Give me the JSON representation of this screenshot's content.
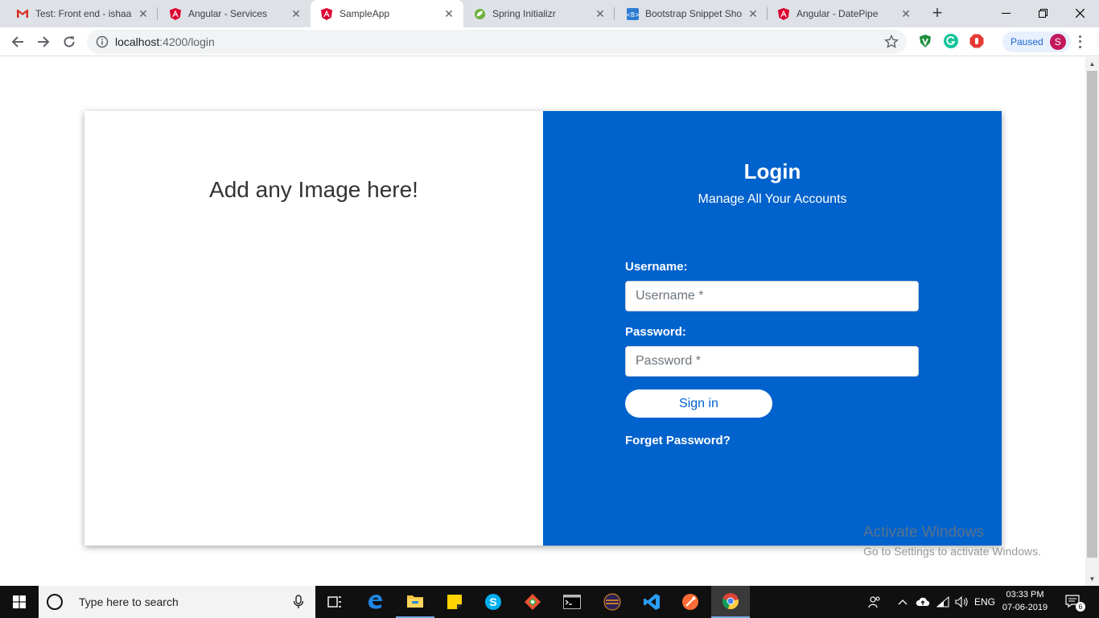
{
  "browser": {
    "tabs": [
      {
        "title": "Test: Front end - ishaan",
        "icon": "gmail-icon"
      },
      {
        "title": "Angular - Services",
        "icon": "angular-icon"
      },
      {
        "title": "SampleApp",
        "icon": "angular-icon",
        "active": true
      },
      {
        "title": "Spring Initializr",
        "icon": "spring-icon"
      },
      {
        "title": "Bootstrap Snippet Shop",
        "icon": "bootstrap-icon"
      },
      {
        "title": "Angular - DatePipe",
        "icon": "angular-icon"
      }
    ],
    "url_host": "localhost",
    "url_path": ":4200/login",
    "profile_status": "Paused",
    "profile_initial": "S"
  },
  "page": {
    "image_placeholder": "Add any Image here!",
    "login_title": "Login",
    "login_subtitle": "Manage All Your Accounts",
    "username_label": "Username:",
    "username_placeholder": "Username *",
    "password_label": "Password:",
    "password_placeholder": "Password *",
    "signin_label": "Sign in",
    "forgot_label": "Forget Password?",
    "accent_color": "#0062cc"
  },
  "watermark": {
    "line1": "Activate Windows",
    "line2": "Go to Settings to activate Windows."
  },
  "taskbar": {
    "search_placeholder": "Type here to search",
    "language": "ENG",
    "time": "03:33 PM",
    "date": "07-06-2019",
    "notification_count": "6"
  }
}
